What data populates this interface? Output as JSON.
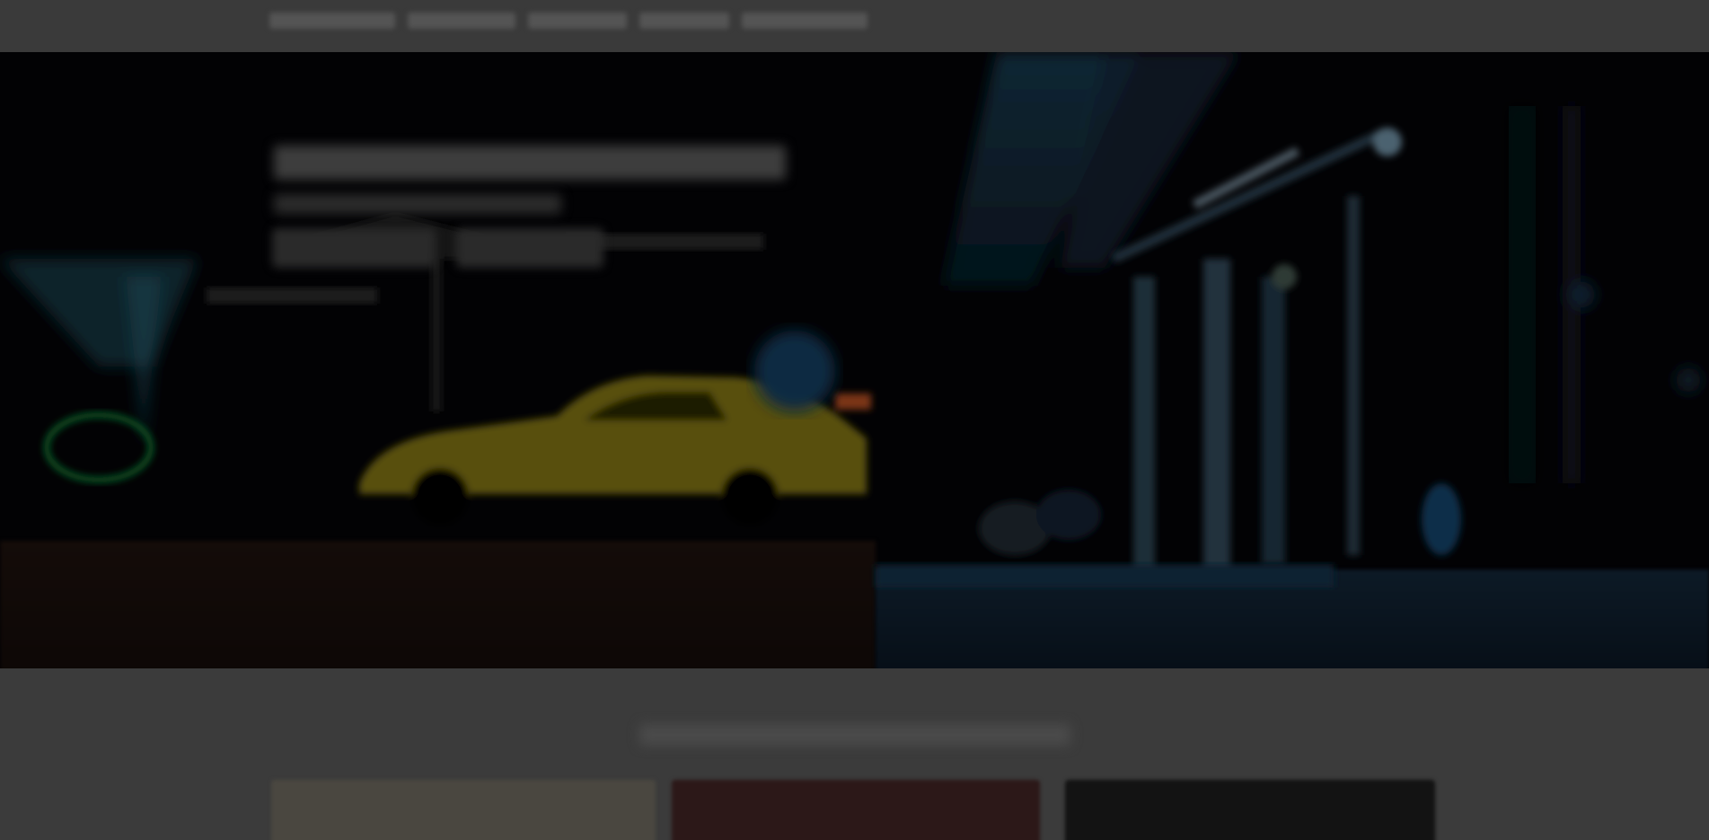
{
  "nav": {
    "items": [
      {
        "label": ""
      },
      {
        "label": ""
      },
      {
        "label": ""
      },
      {
        "label": ""
      },
      {
        "label": ""
      }
    ]
  },
  "hero": {
    "title": "",
    "subtitle": "",
    "primary_button": "",
    "secondary_button": ""
  },
  "section": {
    "title": ""
  },
  "cards": [
    {
      "label": ""
    },
    {
      "label": ""
    },
    {
      "label": ""
    }
  ],
  "colors": {
    "page_background": "#3b3b3b",
    "hero_background": "#020204",
    "car": "#c9b515",
    "building_glow": "#3c6f98"
  }
}
